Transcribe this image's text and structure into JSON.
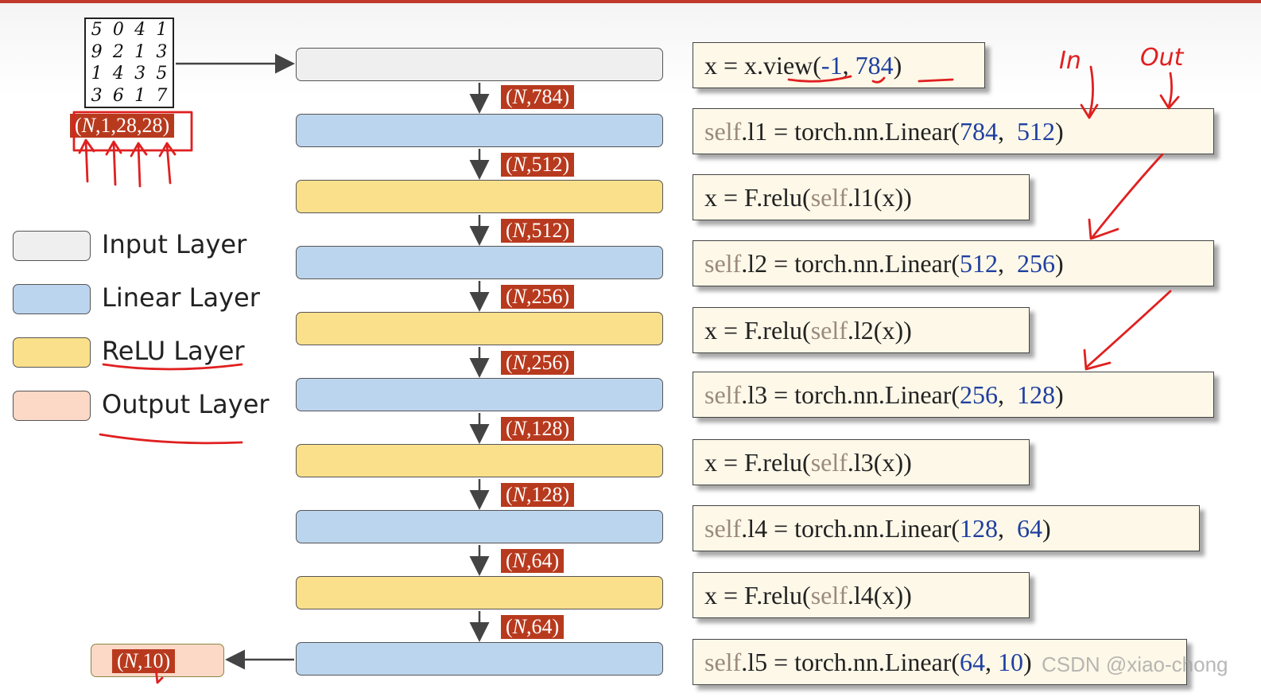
{
  "mnist_digits": [
    "5",
    "0",
    "4",
    "1",
    "9",
    "2",
    "1",
    "3",
    "1",
    "4",
    "3",
    "5",
    "3",
    "6",
    "1",
    "7"
  ],
  "input_shape": {
    "n": "N",
    "rest": ",1,28,28)"
  },
  "layers": [
    {
      "kind": "input"
    },
    {
      "kind": "linear"
    },
    {
      "kind": "relu"
    },
    {
      "kind": "linear"
    },
    {
      "kind": "relu"
    },
    {
      "kind": "linear"
    },
    {
      "kind": "relu"
    },
    {
      "kind": "linear"
    },
    {
      "kind": "relu"
    },
    {
      "kind": "linear"
    }
  ],
  "shapes": [
    {
      "n": "N",
      "rest": ",784)"
    },
    {
      "n": "N",
      "rest": ",512)"
    },
    {
      "n": "N",
      "rest": ",512)"
    },
    {
      "n": "N",
      "rest": ",256)"
    },
    {
      "n": "N",
      "rest": ",256)"
    },
    {
      "n": "N",
      "rest": ",128)"
    },
    {
      "n": "N",
      "rest": ",128)"
    },
    {
      "n": "N",
      "rest": ",64)"
    },
    {
      "n": "N",
      "rest": ",64)"
    }
  ],
  "output_shape": {
    "n": "N",
    "rest": ",10)"
  },
  "legend": [
    {
      "label": "Input Layer",
      "color": "#efefef"
    },
    {
      "label": "Linear Layer",
      "color": "#bcd5ee"
    },
    {
      "label": "ReLU Layer",
      "color": "#fbe08c"
    },
    {
      "label": "Output Layer",
      "color": "#fcd8c6"
    }
  ],
  "code": {
    "view": {
      "pre": "x = x.view(",
      "a": "-1",
      "sep": ", ",
      "b": "784",
      "post": ")"
    },
    "l1": {
      "self": "self",
      "pre": ".l1 = torch.nn.Linear(",
      "a": "784",
      "sep": ",  ",
      "b": "512",
      "post": ")"
    },
    "r1": {
      "pre": "x = F.relu(",
      "self": "self",
      "post": ".l1(x))"
    },
    "l2": {
      "self": "self",
      "pre": ".l2 = torch.nn.Linear(",
      "a": "512",
      "sep": ",  ",
      "b": "256",
      "post": ")"
    },
    "r2": {
      "pre": "x = F.relu(",
      "self": "self",
      "post": ".l2(x))"
    },
    "l3": {
      "self": "self",
      "pre": ".l3 = torch.nn.Linear(",
      "a": "256",
      "sep": ",  ",
      "b": "128",
      "post": ")"
    },
    "r3": {
      "pre": "x = F.relu(",
      "self": "self",
      "post": ".l3(x))"
    },
    "l4": {
      "self": "self",
      "pre": ".l4 = torch.nn.Linear(",
      "a": "128",
      "sep": ",  ",
      "b": "64",
      "post": ")"
    },
    "r4": {
      "pre": "x = F.relu(",
      "self": "self",
      "post": ".l4(x))"
    },
    "l5": {
      "self": "self",
      "pre": ".l5 = torch.nn.Linear(",
      "a": "64",
      "sep": ", ",
      "b": "10",
      "post": ")"
    }
  },
  "annotations": {
    "in": "In",
    "out": "Out",
    "color": "#e02020"
  },
  "watermark": "CSDN @xiao-chong",
  "colors": {
    "accent": "#b83a1e",
    "code_number": "#1f3fa0",
    "code_self": "#9b8a7c"
  }
}
